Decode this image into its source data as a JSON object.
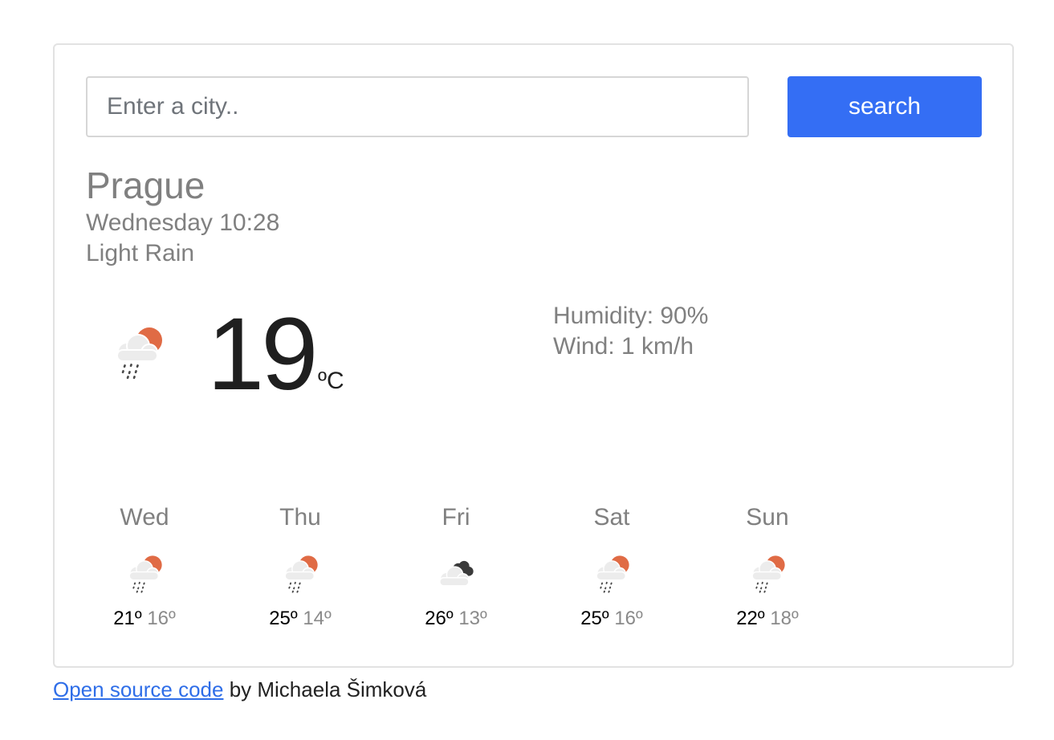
{
  "search": {
    "placeholder": "Enter a city..",
    "button_label": "search"
  },
  "current": {
    "city": "Prague",
    "datetime": "Wednesday 10:28",
    "description": "Light Rain",
    "icon": "light-rain-icon",
    "temperature": "19",
    "unit": "ºC",
    "humidity": "Humidity: 90%",
    "wind": "Wind: 1 km/h"
  },
  "forecast": [
    {
      "day": "Wed",
      "icon": "light-rain-icon",
      "max": "21º",
      "min": "16º"
    },
    {
      "day": "Thu",
      "icon": "light-rain-icon",
      "max": "25º",
      "min": "14º"
    },
    {
      "day": "Fri",
      "icon": "cloudy-icon",
      "max": "26º",
      "min": "13º"
    },
    {
      "day": "Sat",
      "icon": "light-rain-icon",
      "max": "25º",
      "min": "16º"
    },
    {
      "day": "Sun",
      "icon": "light-rain-icon",
      "max": "22º",
      "min": "18º"
    }
  ],
  "footer": {
    "link_text": "Open source code",
    "by_text": " by Michaela Šimková"
  },
  "colors": {
    "accent": "#346ef4",
    "link": "#2f6ee8",
    "sun": "#e06b45",
    "cloud": "#ececec",
    "dark_cloud": "#3a3a3a"
  }
}
